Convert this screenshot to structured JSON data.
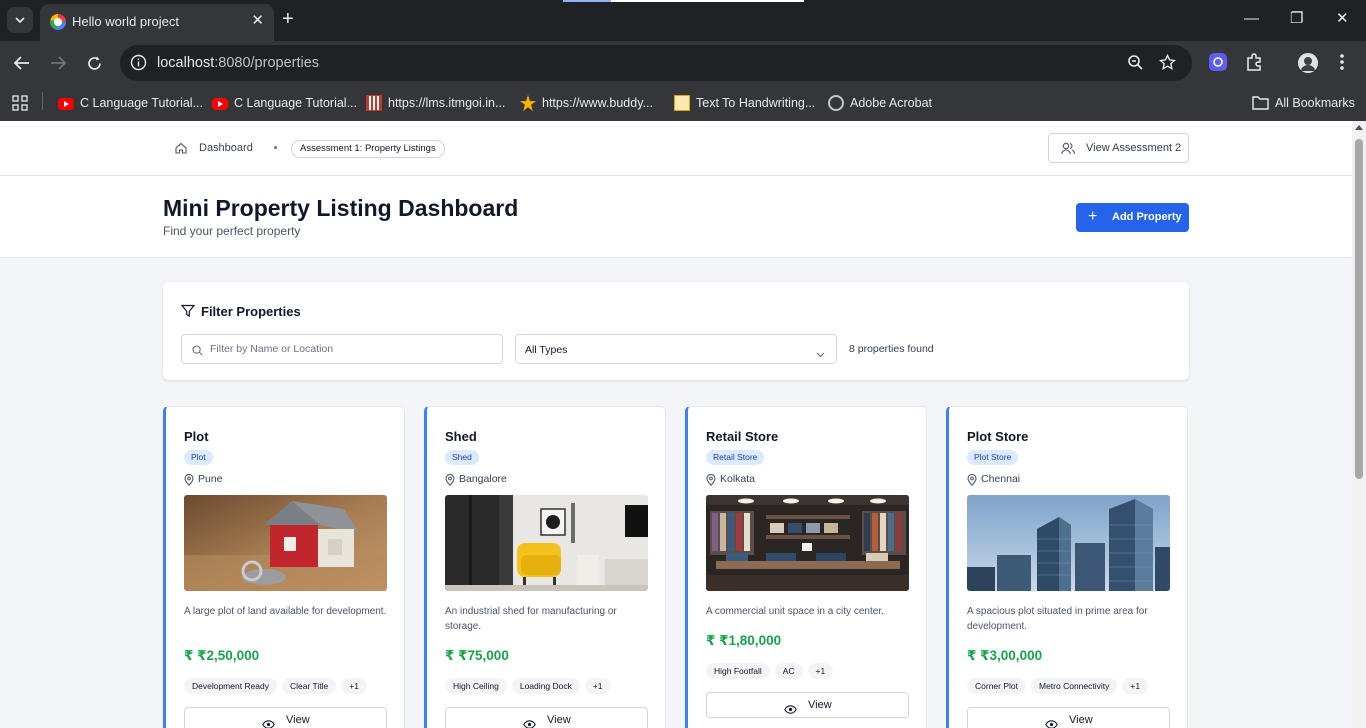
{
  "browser": {
    "tab_title": "Hello world project",
    "url_host": "localhost",
    "url_rest": ":8080/properties",
    "bookmarks": [
      {
        "label": "C Language Tutorial..."
      },
      {
        "label": "C Language Tutorial..."
      },
      {
        "label": "https://lms.itmgoi.in..."
      },
      {
        "label": "https://www.buddy..."
      },
      {
        "label": "Text To Handwriting..."
      },
      {
        "label": "Adobe Acrobat"
      }
    ],
    "all_bookmarks": "All Bookmarks"
  },
  "topnav": {
    "crumb_dashboard": "Dashboard",
    "crumb_current": "Assessment 1: Property Listings",
    "view_assessment": "View Assessment 2"
  },
  "header": {
    "title": "Mini Property Listing Dashboard",
    "subtitle": "Find your perfect property",
    "add_button": "Add Property"
  },
  "filter": {
    "title": "Filter Properties",
    "search_placeholder": "Filter by Name or Location",
    "type_selected": "All Types",
    "found_text": "8 properties found"
  },
  "colors": {
    "primary": "#2563eb",
    "price": "#16a34a",
    "card_accent": "#3b82f6",
    "badge_bg": "#dbeafe"
  },
  "cards": [
    {
      "name": "Plot",
      "type": "Plot",
      "location": "Pune",
      "description": "A large plot of land available for development.",
      "price": "₹ ₹2,50,000",
      "tags": [
        "Development Ready",
        "Clear Title",
        "+1"
      ],
      "view": "View"
    },
    {
      "name": "Shed",
      "type": "Shed",
      "location": "Bangalore",
      "description": "An industrial shed for manufacturing or storage.",
      "price": "₹ ₹75,000",
      "tags": [
        "High Ceiling",
        "Loading Dock",
        "+1"
      ],
      "view": "View"
    },
    {
      "name": "Retail Store",
      "type": "Retail Store",
      "location": "Kolkata",
      "description": "A commercial unit space in a city center.",
      "price": "₹ ₹1,80,000",
      "tags": [
        "High Footfall",
        "AC",
        "+1"
      ],
      "view": "View"
    },
    {
      "name": "Plot Store",
      "type": "Plot Store",
      "location": "Chennai",
      "description": "A spacious plot situated in prime area for development.",
      "price": "₹ ₹3,00,000",
      "tags": [
        "Corner Plot",
        "Metro Connectivity",
        "+1"
      ],
      "view": "View"
    }
  ]
}
